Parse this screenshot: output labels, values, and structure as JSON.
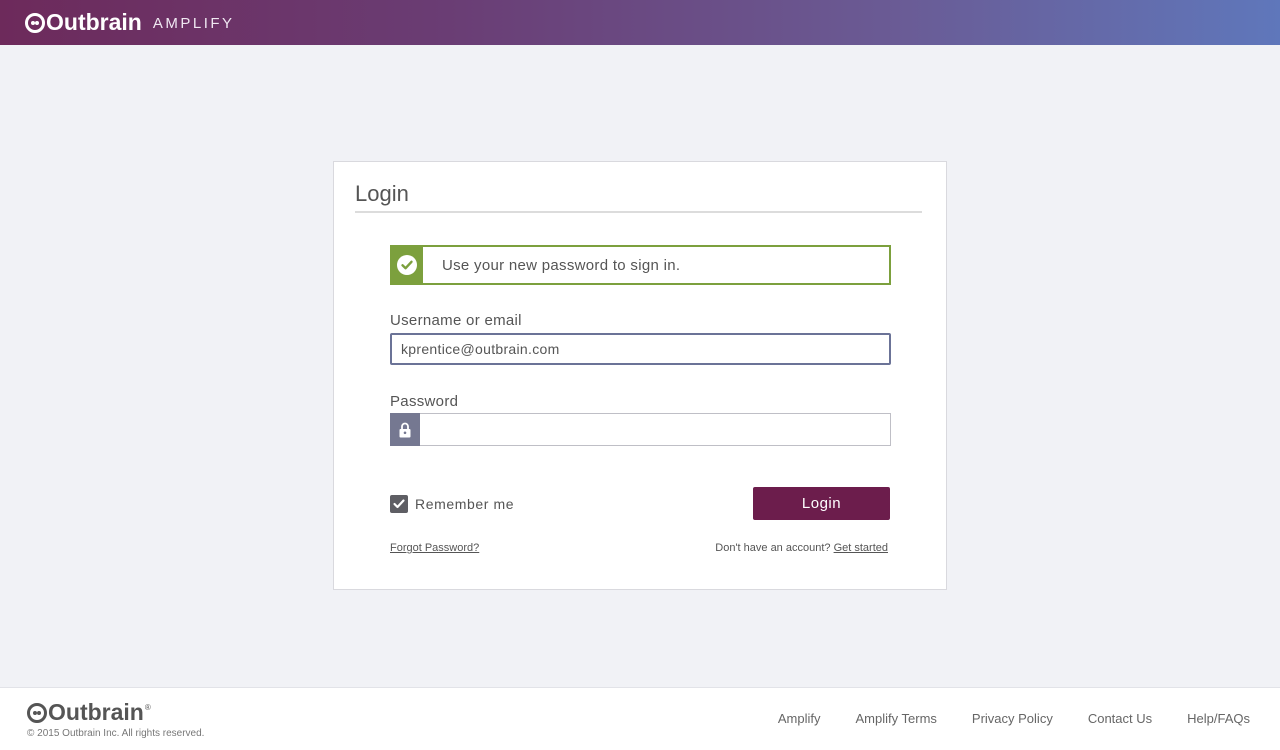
{
  "header": {
    "brand_name": "Outbrain",
    "brand_sub": "AMPLIFY",
    "gradient_colors": [
      "#6d2a5b",
      "#5f77bb"
    ]
  },
  "login_card": {
    "title": "Login",
    "alert": {
      "message": "Use your new password to sign in.",
      "color": "#7ca03d",
      "icon": "check-circle-icon"
    },
    "username": {
      "label": "Username or email",
      "value": "kprentice@outbrain.com"
    },
    "password": {
      "label": "Password",
      "value": "",
      "icon": "lock-icon"
    },
    "remember": {
      "label": "Remember me",
      "checked": true
    },
    "login_button": {
      "label": "Login",
      "color": "#6c1d4c"
    },
    "forgot_link": "Forgot Password?",
    "signup_prompt": "Don't have an account?",
    "signup_link": "Get started"
  },
  "footer": {
    "brand_name": "Outbrain",
    "registered_mark": "®",
    "copyright": "© 2015 Outbrain Inc. All rights reserved.",
    "links": [
      {
        "label": "Amplify"
      },
      {
        "label": "Amplify Terms"
      },
      {
        "label": "Privacy Policy"
      },
      {
        "label": "Contact Us"
      },
      {
        "label": "Help/FAQs"
      }
    ]
  }
}
